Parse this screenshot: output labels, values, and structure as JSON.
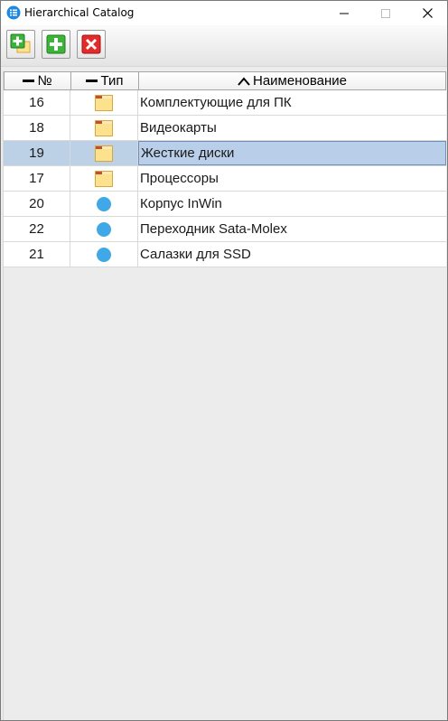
{
  "window": {
    "title": "Hierarchical Catalog",
    "min_glyph": "—",
    "max_glyph": "☐",
    "close_glyph": "✕"
  },
  "toolbar": {
    "buttons": [
      {
        "id": "add-group",
        "icon": "add-folder-icon"
      },
      {
        "id": "add-item",
        "icon": "add-icon"
      },
      {
        "id": "delete",
        "icon": "delete-icon"
      }
    ]
  },
  "grid": {
    "columns": [
      {
        "label": "№",
        "sort": "none"
      },
      {
        "label": "Тип",
        "sort": "none"
      },
      {
        "label": "Наименование",
        "sort": "ascending"
      }
    ],
    "rows": [
      {
        "num": "16",
        "type": "folder",
        "name": "Комплектующие для ПК",
        "selected": false
      },
      {
        "num": "18",
        "type": "folder",
        "name": "Видеокарты",
        "selected": false
      },
      {
        "num": "19",
        "type": "folder",
        "name": "Жесткие диски",
        "selected": true
      },
      {
        "num": "17",
        "type": "folder",
        "name": "Процессоры",
        "selected": false
      },
      {
        "num": "20",
        "type": "item",
        "name": "Корпус InWin",
        "selected": false
      },
      {
        "num": "22",
        "type": "item",
        "name": "Переходник Sata-Molex",
        "selected": false
      },
      {
        "num": "21",
        "type": "item",
        "name": "Салазки для SSD",
        "selected": false
      }
    ]
  },
  "colors": {
    "selection": "#bcd0e6",
    "item_dot": "#40a8e6",
    "folder": "#fde28e",
    "folder_tab": "#c0502d"
  }
}
